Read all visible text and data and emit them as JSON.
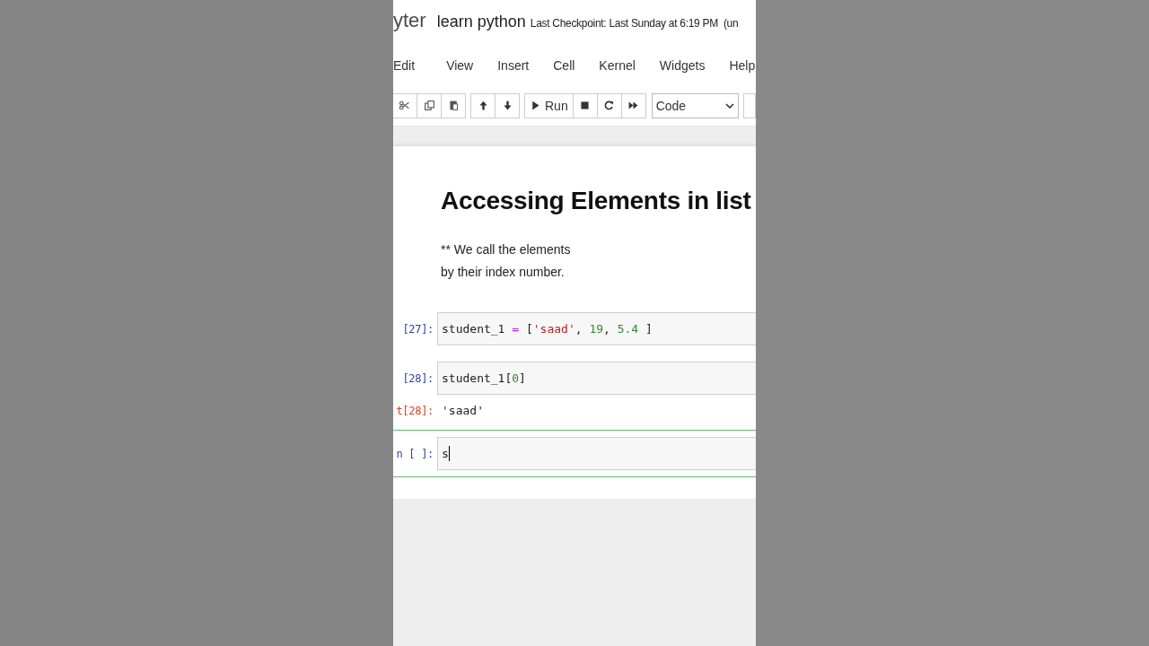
{
  "header": {
    "logo_text": "yter",
    "notebook_name": "learn python",
    "checkpoint": "Last Checkpoint: Last Sunday at 6:19 PM",
    "status": "(un"
  },
  "menu": [
    {
      "label": "Edit"
    },
    {
      "label": "View"
    },
    {
      "label": "Insert"
    },
    {
      "label": "Cell"
    },
    {
      "label": "Kernel"
    },
    {
      "label": "Widgets"
    },
    {
      "label": "Help"
    }
  ],
  "toolbar": {
    "groups": [
      [
        {
          "kind": "scissors"
        },
        {
          "kind": "copy"
        },
        {
          "kind": "paste"
        }
      ],
      [
        {
          "kind": "up"
        },
        {
          "kind": "down"
        }
      ],
      [
        {
          "kind": "run"
        },
        {
          "kind": "stop"
        },
        {
          "kind": "restart"
        },
        {
          "kind": "fast-forward"
        }
      ]
    ],
    "run_label": "Run",
    "cell_type": "Code"
  },
  "markdown": {
    "heading": "Accessing Elements in list",
    "lines": [
      "** We call the elements",
      "by their index number."
    ]
  },
  "cells": [
    {
      "prompt": "[27]:",
      "selected": false,
      "tokens": [
        {
          "kind": "name",
          "text": "student_1 "
        },
        {
          "kind": "op",
          "text": "="
        },
        {
          "kind": "punct",
          "text": " ["
        },
        {
          "kind": "str",
          "text": "'saad'"
        },
        {
          "kind": "punct",
          "text": ", "
        },
        {
          "kind": "num",
          "text": "19"
        },
        {
          "kind": "punct",
          "text": ", "
        },
        {
          "kind": "num",
          "text": "5.4"
        },
        {
          "kind": "punct",
          "text": " ]"
        }
      ]
    },
    {
      "prompt": "[28]:",
      "selected": false,
      "tokens": [
        {
          "kind": "name",
          "text": "student_1"
        },
        {
          "kind": "punct",
          "text": "["
        },
        {
          "kind": "num",
          "text": "0"
        },
        {
          "kind": "punct",
          "text": "]"
        }
      ],
      "output": {
        "prompt": "t[28]:",
        "text": "'saad'"
      }
    },
    {
      "prompt": "n [ ]:",
      "selected": true,
      "tokens": [
        {
          "kind": "name",
          "text": "s"
        }
      ]
    }
  ]
}
